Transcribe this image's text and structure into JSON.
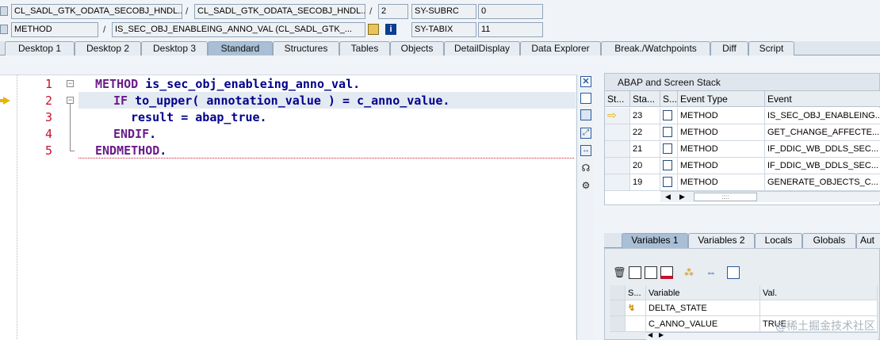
{
  "header": {
    "row1": {
      "program": "CL_SADL_GTK_ODATA_SECOBJ_HNDL...",
      "include": "CL_SADL_GTK_ODATA_SECOBJ_HNDL...",
      "line": "2",
      "sy_label_1": "SY-SUBRC",
      "sy_value_1": "0"
    },
    "row2": {
      "event_type": "METHOD",
      "event": "IS_SEC_OBJ_ENABLEING_ANNO_VAL (CL_SADL_GTK_...",
      "sy_label_2": "SY-TABIX",
      "sy_value_2": "11"
    }
  },
  "tabs": [
    "Desktop 1",
    "Desktop 2",
    "Desktop 3",
    "Standard",
    "Structures",
    "Tables",
    "Objects",
    "DetailDisplay",
    "Data Explorer",
    "Break./Watchpoints",
    "Diff",
    "Script"
  ],
  "active_tab": "Standard",
  "editor": {
    "line_numbers": [
      "1",
      "2",
      "3",
      "4",
      "5"
    ],
    "lines": [
      {
        "kw": "METHOD",
        "rest": " is_sec_obj_enableing_anno_val."
      },
      {
        "kw": "IF",
        "rest": " to_upper( annotation_value ) = c_anno_value."
      },
      {
        "kw": "",
        "rest": "result = abap_true."
      },
      {
        "kw": "ENDIF",
        "rest": "."
      },
      {
        "kw": "ENDMETHOD",
        "rest": "."
      }
    ]
  },
  "stack": {
    "title": "ABAP and Screen Stack",
    "columns": [
      "St...",
      "Sta...",
      "S...",
      "Event Type",
      "Event"
    ],
    "rows": [
      {
        "level": "23",
        "type": "METHOD",
        "event": "IS_SEC_OBJ_ENABLEING..."
      },
      {
        "level": "22",
        "type": "METHOD",
        "event": "GET_CHANGE_AFFECTE..."
      },
      {
        "level": "21",
        "type": "METHOD",
        "event": "IF_DDIC_WB_DDLS_SEC..."
      },
      {
        "level": "20",
        "type": "METHOD",
        "event": "IF_DDIC_WB_DDLS_SEC..."
      },
      {
        "level": "19",
        "type": "METHOD",
        "event": "GENERATE_OBJECTS_C..."
      }
    ],
    "scroll": "::::"
  },
  "var_tabs": [
    "Variables 1",
    "Variables 2",
    "Locals",
    "Globals",
    "Aut"
  ],
  "active_var_tab": "Variables 1",
  "variables": {
    "columns": [
      "S...",
      "Variable",
      "Val."
    ],
    "rows": [
      {
        "name": "DELTA_STATE",
        "value": ""
      },
      {
        "name": "C_ANNO_VALUE",
        "value": "TRUE"
      }
    ]
  },
  "watermark": "@稀土掘金技术社区"
}
